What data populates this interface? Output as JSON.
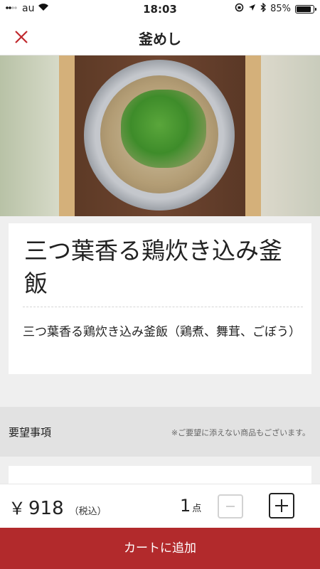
{
  "status_bar": {
    "carrier": "au",
    "time": "18:03",
    "battery": "85%",
    "battery_level": 0.85
  },
  "nav": {
    "title": "釜めし"
  },
  "product": {
    "name": "三つ葉香る鶏炊き込み釜飯",
    "description": "三つ葉香る鶏炊き込み釜飯（鶏煮、舞茸、ごぼう）"
  },
  "request": {
    "label": "要望事項",
    "note": "※ご要望に添えない商品もございます。"
  },
  "order": {
    "currency": "￥",
    "price": "918",
    "tax_note": "（税込）",
    "quantity": "1",
    "unit": "点"
  },
  "cart_button": {
    "label": "カートに追加"
  },
  "colors": {
    "accent": "#b22a2c",
    "close_icon": "#c0282d"
  }
}
